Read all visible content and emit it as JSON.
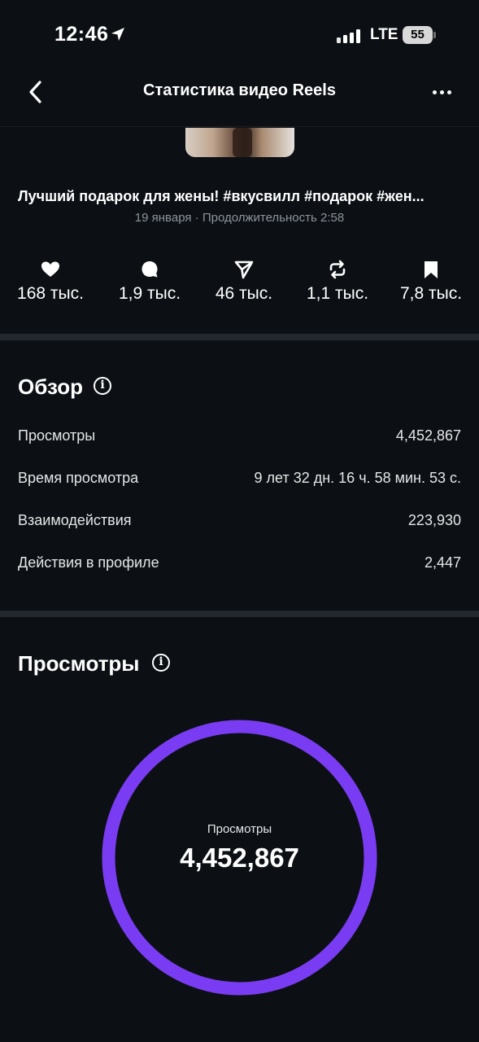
{
  "status_bar": {
    "time": "12:46",
    "network": "LTE",
    "battery": "55",
    "icons": [
      "location-arrow-icon",
      "signal-icon",
      "battery-icon"
    ]
  },
  "nav": {
    "title": "Статистика видео Reels",
    "back_icon": "chevron-left-icon",
    "more_icon": "more-dots-icon"
  },
  "video": {
    "title": "Лучший подарок для жены! #вкусвилл #подарок #жен...",
    "meta": "19 января · Продолжительность 2:58"
  },
  "stats": [
    {
      "icon": "heart-icon",
      "value": "168 тыс."
    },
    {
      "icon": "comment-icon",
      "value": "1,9 тыс."
    },
    {
      "icon": "send-icon",
      "value": "46 тыс."
    },
    {
      "icon": "repost-icon",
      "value": "1,1 тыс."
    },
    {
      "icon": "bookmark-icon",
      "value": "7,8 тыс."
    }
  ],
  "overview": {
    "title": "Обзор",
    "rows": [
      {
        "label": "Просмотры",
        "value": "4,452,867"
      },
      {
        "label": "Время просмотра",
        "value": "9 лет 32 дн. 16 ч. 58 мин. 53 с."
      },
      {
        "label": "Взаимодействия",
        "value": "223,930"
      },
      {
        "label": "Действия в профиле",
        "value": "2,447"
      }
    ]
  },
  "views": {
    "title": "Просмотры",
    "ring_label": "Просмотры",
    "ring_value": "4,452,867",
    "ring_color": "#7a3cf2",
    "ring_fill": 1.0
  },
  "colors": {
    "background": "#0c1015",
    "divider": "#23282e",
    "muted_text": "#8d939b",
    "accent": "#7a3cf2"
  }
}
